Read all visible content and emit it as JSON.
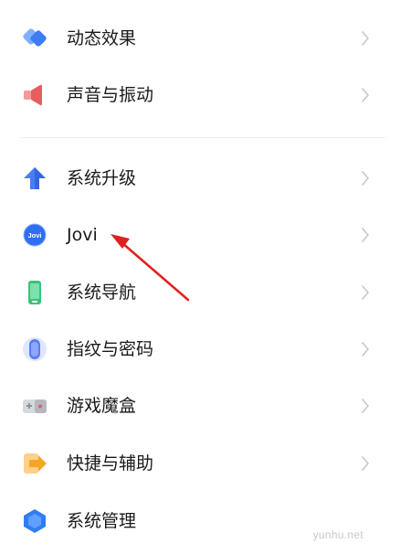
{
  "settings": {
    "items": [
      {
        "id": "dynamic-effects",
        "label": "动态效果",
        "icon": "layers-icon",
        "color": "#3d7cf3"
      },
      {
        "id": "sound-vibration",
        "label": "声音与振动",
        "icon": "speaker-icon",
        "color": "#e85d5d"
      },
      {
        "id": "system-update",
        "label": "系统升级",
        "icon": "up-arrow-icon",
        "color": "#4a7cf2"
      },
      {
        "id": "jovi",
        "label": "Jovi",
        "icon": "jovi-icon",
        "color": "#2f6ef0",
        "icon_text": "Jovi"
      },
      {
        "id": "system-navigation",
        "label": "系统导航",
        "icon": "phone-icon",
        "color": "#37c47a"
      },
      {
        "id": "fingerprint-password",
        "label": "指纹与密码",
        "icon": "fingerprint-icon",
        "color": "#5b7cf6"
      },
      {
        "id": "game-box",
        "label": "游戏魔盒",
        "icon": "gamepad-icon",
        "color": "#9aa0a8"
      },
      {
        "id": "shortcuts-assist",
        "label": "快捷与辅助",
        "icon": "shortcut-icon",
        "color": "#f5a623"
      },
      {
        "id": "system-management",
        "label": "系统管理",
        "icon": "hexagon-icon",
        "color": "#2f7df2"
      }
    ]
  },
  "watermark": "yunhu.net",
  "colors": {
    "annotation_arrow": "#e02020",
    "chevron": "#c7c7cc"
  }
}
